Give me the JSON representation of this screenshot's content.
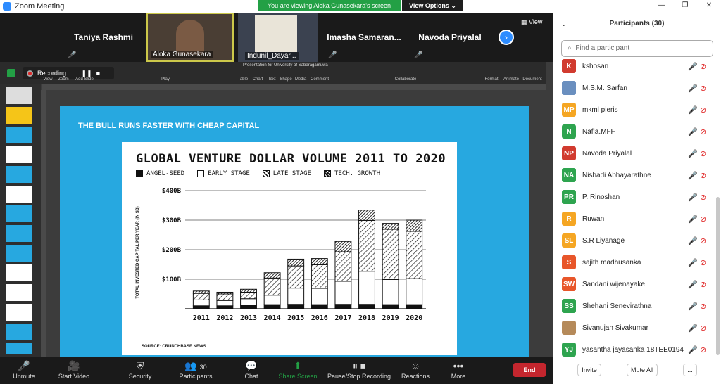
{
  "window": {
    "title": "Zoom Meeting"
  },
  "banner": {
    "viewing": "You are viewing Aloka Gunasekara's screen",
    "view_options": "View Options ⌄"
  },
  "video_strip": {
    "tiles": [
      {
        "name": "Taniya Rashmi",
        "type": "name"
      },
      {
        "name": "Aloka Gunasekara",
        "type": "video",
        "active": true
      },
      {
        "name": "Indunil_Dayar...",
        "type": "video"
      },
      {
        "name": "Imasha  Samaran...",
        "type": "name"
      },
      {
        "name": "Navoda Priyalal",
        "type": "name"
      }
    ],
    "view_label": "View"
  },
  "share": {
    "recording_label": "Recording...",
    "ppt_title": "Presentation for University of Sabaragamuwa",
    "toolbar": [
      "View",
      "Zoom",
      "Add Slide",
      "Play",
      "Table",
      "Chart",
      "Text",
      "Shape",
      "Media",
      "Comment",
      "Collaborate",
      "Format",
      "Animate",
      "Document"
    ],
    "slide_heading": "THE BULL RUNS FASTER WITH CHEAP CAPITAL",
    "source": "SOURCE: CRUNCHBASE NEWS"
  },
  "chart_data": {
    "type": "bar",
    "title": "GLOBAL VENTURE DOLLAR VOLUME 2011 TO 2020",
    "ylabel": "TOTAL INVESTED CAPITAL PER YEAR (IN $B)",
    "xlabel": "",
    "ylim": [
      0,
      400
    ],
    "yticks": [
      "$100B",
      "$200B",
      "$300B",
      "$400B"
    ],
    "ytick_values": [
      100,
      200,
      300,
      400
    ],
    "categories": [
      "2011",
      "2012",
      "2013",
      "2014",
      "2015",
      "2016",
      "2017",
      "2018",
      "2019",
      "2020"
    ],
    "stacked": true,
    "legend_position": "top",
    "series": [
      {
        "name": "ANGEL-SEED",
        "values": [
          10,
          10,
          12,
          14,
          15,
          14,
          15,
          15,
          14,
          14
        ]
      },
      {
        "name": "EARLY STAGE",
        "values": [
          20,
          18,
          22,
          32,
          55,
          55,
          78,
          112,
          85,
          88
        ]
      },
      {
        "name": "LATE STAGE",
        "values": [
          22,
          22,
          22,
          58,
          75,
          80,
          100,
          172,
          170,
          160
        ]
      },
      {
        "name": "TECH. GROWTH",
        "values": [
          8,
          6,
          10,
          18,
          23,
          21,
          35,
          35,
          20,
          38
        ]
      }
    ]
  },
  "bottom_bar": {
    "unmute": "Unmute",
    "start_video": "Start Video",
    "security": "Security",
    "participants": "Participants",
    "participants_count": "30",
    "chat": "Chat",
    "share_screen": "Share Screen",
    "pause_recording": "Pause/Stop Recording",
    "reactions": "Reactions",
    "more": "More",
    "end": "End"
  },
  "panel": {
    "title": "Participants (30)",
    "search_placeholder": "Find a participant",
    "participants": [
      {
        "initials": "K",
        "name": "kshosan",
        "color": "#d13b2f"
      },
      {
        "initials": "",
        "name": "M.S.M. Sarfan",
        "color": "#6a8fbf",
        "photo": true
      },
      {
        "initials": "MP",
        "name": "mkml pieris",
        "color": "#f5a623"
      },
      {
        "initials": "N",
        "name": "Nafla.MFF",
        "color": "#2ea44f"
      },
      {
        "initials": "NP",
        "name": "Navoda Priyalal",
        "color": "#d13b2f"
      },
      {
        "initials": "NA",
        "name": "Nishadi Abhayarathne",
        "color": "#2ea44f"
      },
      {
        "initials": "PR",
        "name": "P. Rinoshan",
        "color": "#2ea44f"
      },
      {
        "initials": "R",
        "name": "Ruwan",
        "color": "#f5a623"
      },
      {
        "initials": "SL",
        "name": "S.R Liyanage",
        "color": "#f5a623"
      },
      {
        "initials": "S",
        "name": "sajith madhusanka",
        "color": "#e8562a"
      },
      {
        "initials": "SW",
        "name": "Sandani wijenayake",
        "color": "#e8562a"
      },
      {
        "initials": "SS",
        "name": "Shehani Senevirathna",
        "color": "#2ea44f"
      },
      {
        "initials": "",
        "name": "Sivanujan Sivakumar",
        "color": "#b58a5a",
        "photo": true
      },
      {
        "initials": "YJ",
        "name": "yasantha jayasanka 18TEE0194",
        "color": "#2ea44f"
      }
    ],
    "invite": "Invite",
    "mute_all": "Mute All",
    "more": "..."
  }
}
